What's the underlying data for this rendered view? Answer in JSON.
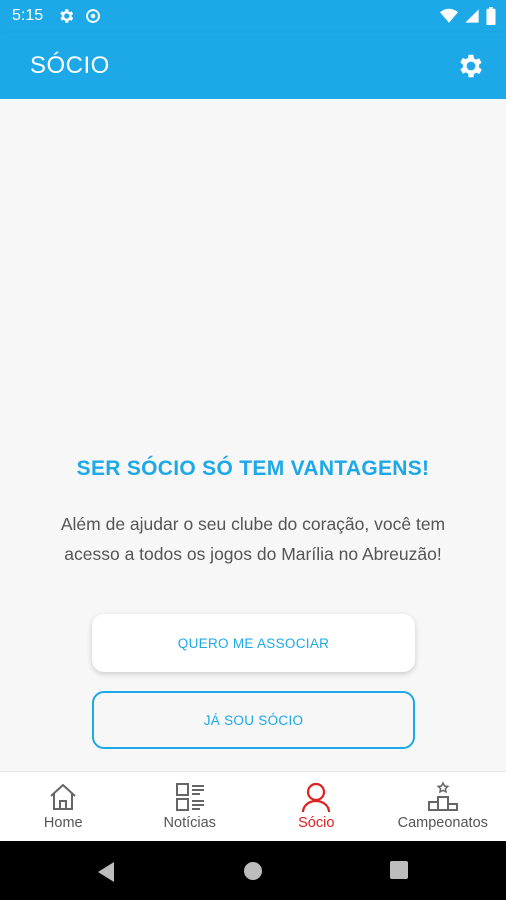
{
  "status_bar": {
    "time": "5:15",
    "icons": [
      "gear-icon",
      "sync-icon",
      "wifi-icon",
      "signal-icon",
      "battery-icon"
    ]
  },
  "app_bar": {
    "title": "SÓCIO",
    "settings_icon": "gear-icon"
  },
  "main": {
    "headline": "SER SÓCIO SÓ TEM VANTAGENS!",
    "description": "Além de ajudar o seu clube do coração, você tem acesso a todos os jogos do Marília no Abreuzão!",
    "primary_button": "QUERO ME ASSOCIAR",
    "secondary_button": "JÁ SOU SÓCIO"
  },
  "bottom_nav": {
    "items": [
      {
        "label": "Home",
        "icon": "home-icon",
        "active": false
      },
      {
        "label": "Notícias",
        "icon": "news-icon",
        "active": false
      },
      {
        "label": "Sócio",
        "icon": "person-icon",
        "active": true
      },
      {
        "label": "Campeonatos",
        "icon": "podium-icon",
        "active": false
      }
    ]
  },
  "system_nav": {
    "buttons": [
      "back-icon",
      "home-circle-icon",
      "recents-icon"
    ]
  },
  "colors": {
    "primary": "#1da8e8",
    "active_nav": "#e02020",
    "background": "#f7f7f7",
    "text": "#555555"
  }
}
